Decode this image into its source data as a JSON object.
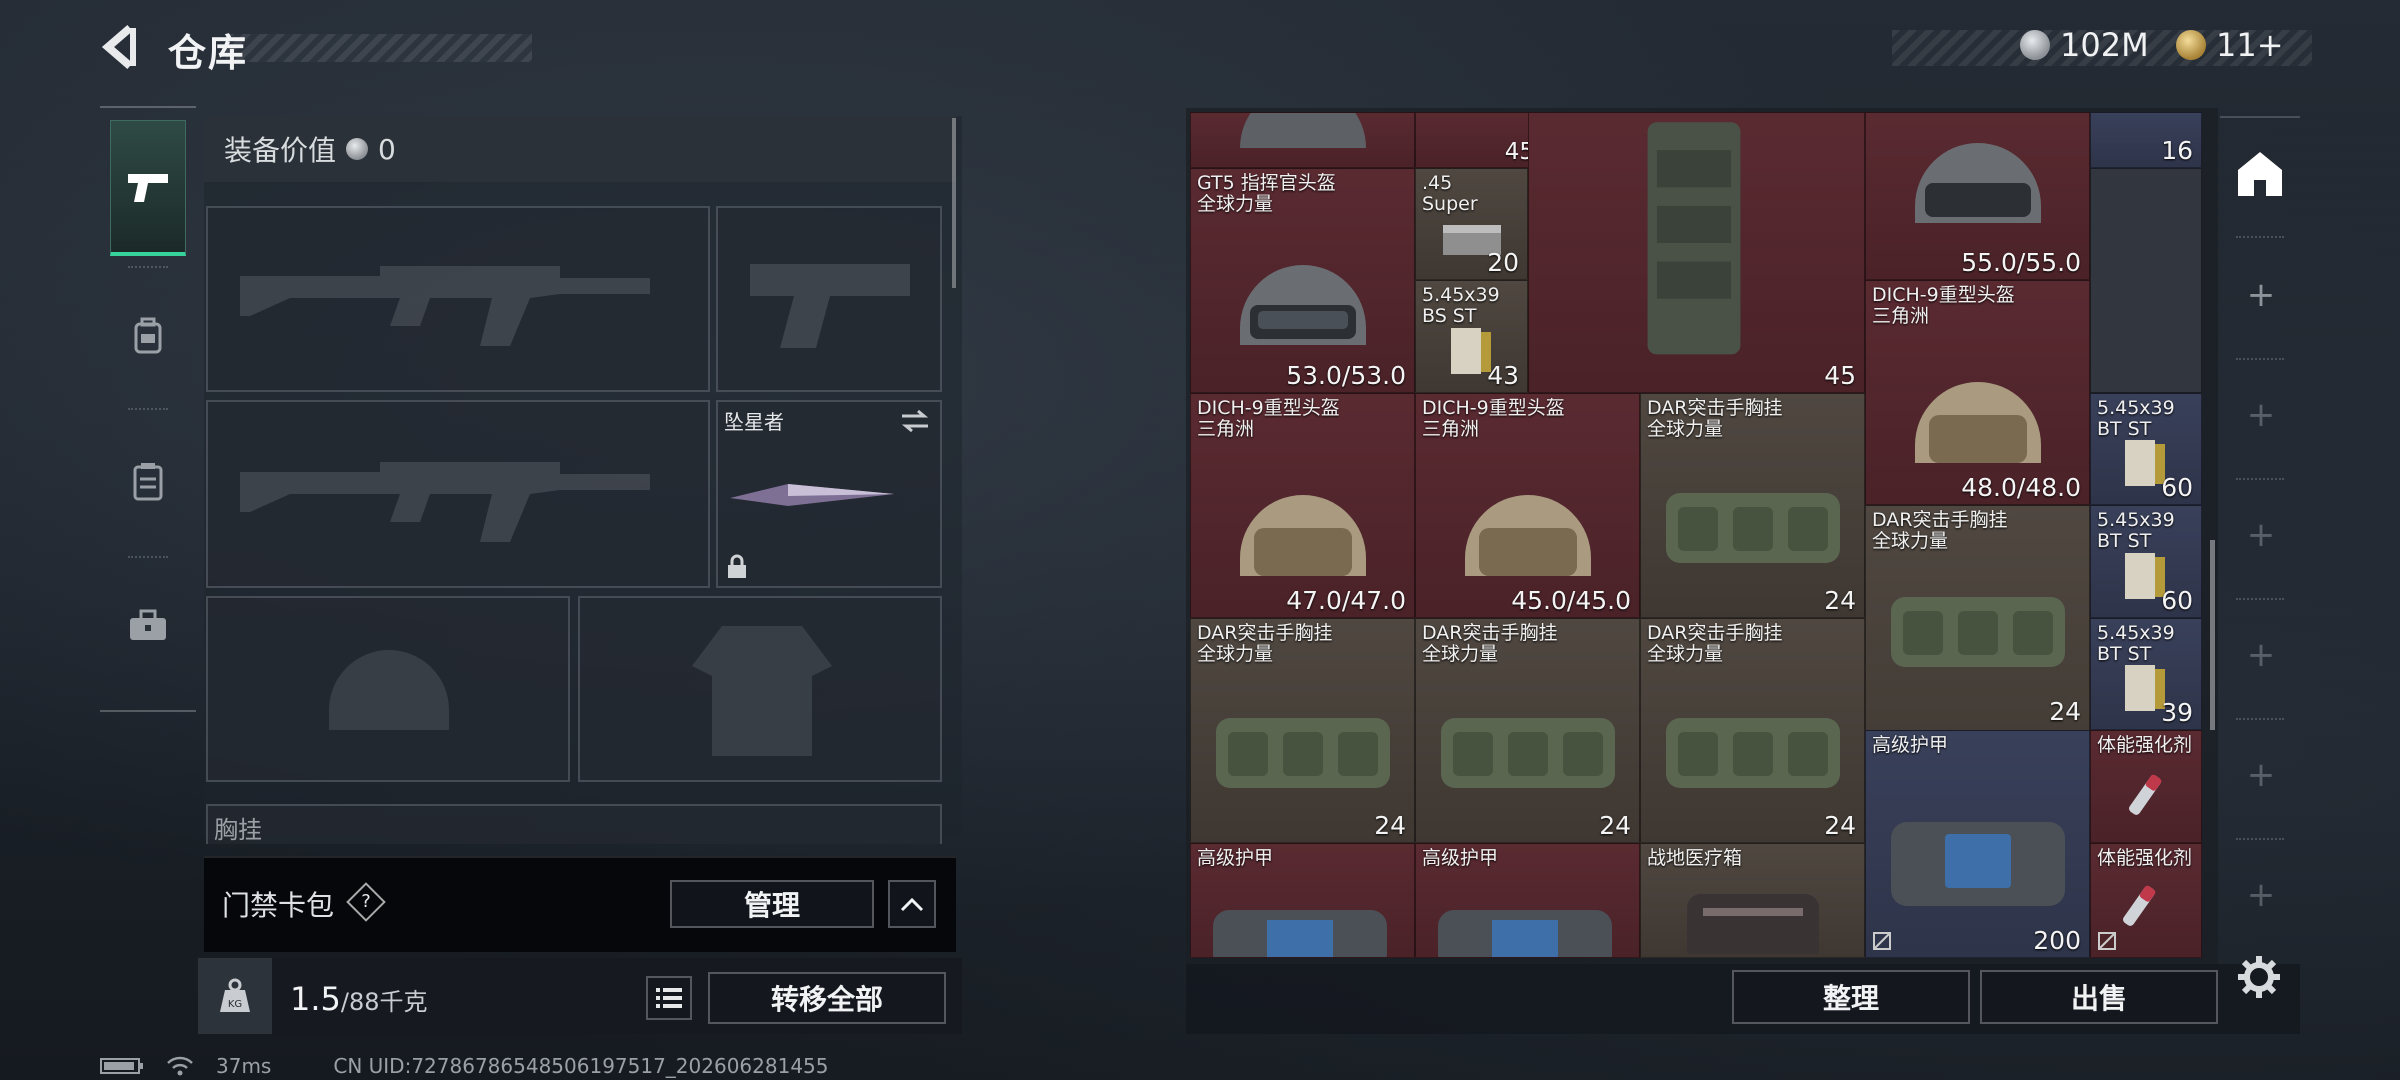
{
  "header": {
    "title": "仓库",
    "currency_silver": "102M",
    "currency_gold": "11+"
  },
  "loadout": {
    "equip_value_label": "装备价值",
    "equip_value": "0",
    "knife_slot_name": "坠星者",
    "chest_rig_label": "胸挂",
    "keycard_label": "门禁卡包",
    "keycard_help": "?",
    "manage_label": "管理",
    "weight_value": "1.5",
    "weight_max": "/88千克",
    "transfer_all_label": "转移全部"
  },
  "status": {
    "ping": "37ms",
    "uid": "CN UID:7278678654850619751​7_202606281455"
  },
  "inventory": {
    "c0_val": "45",
    "c1_val": "16",
    "c2_name": "GT5 指挥官头盔\n全球力量",
    "c2_val": "53.0/53.0",
    "c3_name": ".45\nSuper",
    "c3_val": "20",
    "c4_val": "45",
    "c5_val": "55.0/55.0",
    "c6_name": "5.45x39\nBS ST",
    "c6_val": "43",
    "c7_name": "DICH-9重型头盔\n三角洲",
    "c7_val": "48.0/48.0",
    "c8_name": "DICH-9重型头盔\n三角洲",
    "c8_val": "47.0/47.0",
    "c9_name": "DICH-9重型头盔\n三角洲",
    "c9_val": "45.0/45.0",
    "c10_name": "DAR突击手胸挂\n全球力量",
    "c10_val": "24",
    "c11_name": "5.45x39\nBT ST",
    "c11_val": "60",
    "c12_name": "DAR突击手胸挂\n全球力量",
    "c12_val": "24",
    "c13_name": "5.45x39\nBT ST",
    "c13_val": "60",
    "c14_name": "DAR突击手胸挂\n全球力量",
    "c14_val": "24",
    "c15_name": "DAR突击手胸挂\n全球力量",
    "c15_val": "24",
    "c16_name": "DAR突击手胸挂\n全球力量",
    "c16_val": "24",
    "c17_name": "5.45x39\nBT ST",
    "c17_val": "39",
    "c18_name": "高级护甲",
    "c18_val": "200",
    "c19_name": "体能强化剂",
    "c20_name": "高级护甲",
    "c21_name": "高级护甲",
    "c22_name": "战地医疗箱",
    "c23_name": "体能强化剂",
    "sort_label": "整理",
    "sell_label": "出售"
  },
  "colors": {
    "accent_green": "#36d39b",
    "rarity_red": "#5a2a31",
    "rarity_brown": "#4f4740",
    "rarity_blue": "#39405a"
  },
  "icons": [
    "back-arrow-icon",
    "pistol-icon",
    "backpack-icon",
    "chest-rig-icon",
    "briefcase-icon",
    "lock-icon",
    "swap-icon",
    "weight-icon",
    "list-icon",
    "chevron-up-icon",
    "gear-icon",
    "home-icon",
    "battery-icon",
    "wifi-icon",
    "plus-icon"
  ]
}
